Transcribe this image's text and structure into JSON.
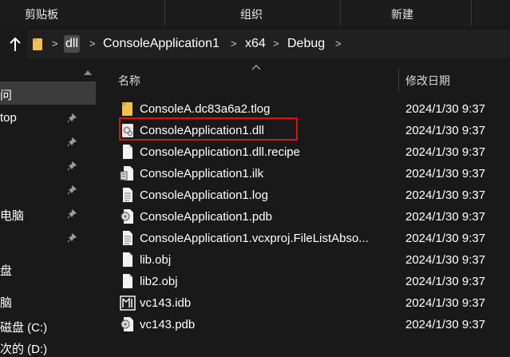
{
  "ribbon": {
    "groups": [
      "剪贴板",
      "组织",
      "新建"
    ]
  },
  "address": {
    "up_icon": "up-arrow-icon",
    "folder_icon": "folder-icon",
    "breadcrumbs": [
      "dll",
      "ConsoleApplication1",
      "x64",
      "Debug"
    ]
  },
  "nav": {
    "items": [
      "问",
      "top",
      "",
      "",
      "",
      "电脑",
      "",
      "盘",
      "脑",
      "磁盘 (C:)",
      "次的 (D:)"
    ],
    "pin_icon": "pin-icon"
  },
  "columns": {
    "name": "名称",
    "modified": "修改日期"
  },
  "files": [
    {
      "name": "ConsoleA.dc83a6a2.tlog",
      "date": "2024/1/30 9:37",
      "icon": "folder-icon"
    },
    {
      "name": "ConsoleApplication1.dll",
      "date": "2024/1/30 9:37",
      "icon": "dll-file-icon"
    },
    {
      "name": "ConsoleApplication1.dll.recipe",
      "date": "2024/1/30 9:37",
      "icon": "blank-file-icon"
    },
    {
      "name": "ConsoleApplication1.ilk",
      "date": "2024/1/30 9:37",
      "icon": "ilk-file-icon"
    },
    {
      "name": "ConsoleApplication1.log",
      "date": "2024/1/30 9:37",
      "icon": "text-file-icon"
    },
    {
      "name": "ConsoleApplication1.pdb",
      "date": "2024/1/30 9:37",
      "icon": "pdb-file-icon"
    },
    {
      "name": "ConsoleApplication1.vcxproj.FileListAbso...",
      "date": "2024/1/30 9:37",
      "icon": "text-file-icon"
    },
    {
      "name": "lib.obj",
      "date": "2024/1/30 9:37",
      "icon": "blank-file-icon"
    },
    {
      "name": "lib2.obj",
      "date": "2024/1/30 9:37",
      "icon": "blank-file-icon"
    },
    {
      "name": "vc143.idb",
      "date": "2024/1/30 9:37",
      "icon": "idb-file-icon"
    },
    {
      "name": "vc143.pdb",
      "date": "2024/1/30 9:37",
      "icon": "pdb-file-icon"
    }
  ],
  "colors": {
    "background": "#191919",
    "highlight_border": "#e01010",
    "folder": "#f0c050"
  }
}
